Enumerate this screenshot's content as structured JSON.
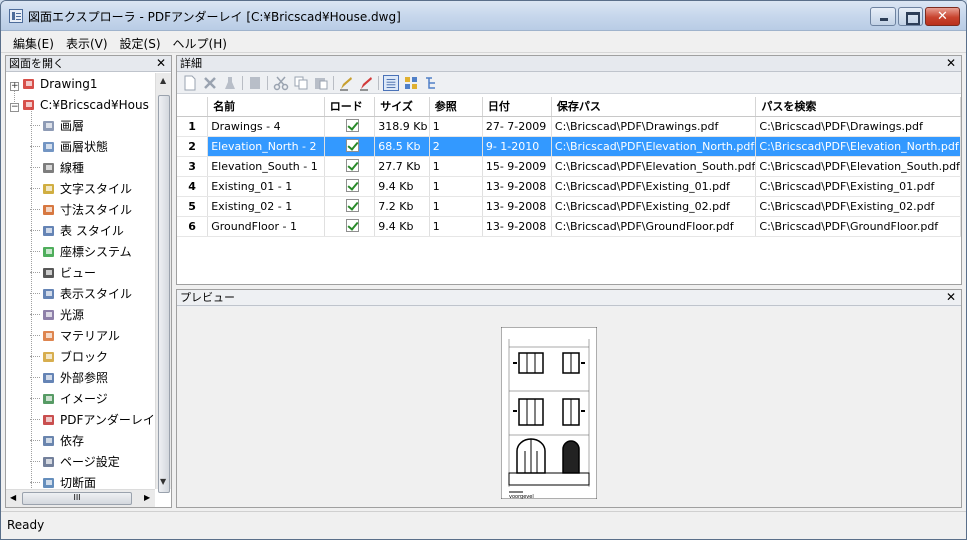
{
  "window": {
    "title": "図面エクスプローラ - PDFアンダーレイ [C:¥Bricscad¥House.dwg]",
    "close_glyph": "✕"
  },
  "menu": [
    "編集(E)",
    "表示(V)",
    "設定(S)",
    "ヘルプ(H)"
  ],
  "left_panel": {
    "title": "図面を開く",
    "close": "✕",
    "tree": [
      {
        "label": "Drawing1",
        "icon": "drawing-icon",
        "level": 0,
        "expander": "+"
      },
      {
        "label": "C:¥Bricscad¥Hous",
        "icon": "drawing-icon",
        "level": 0,
        "expander": "−"
      },
      {
        "label": "画層",
        "icon": "layers-icon",
        "level": 1
      },
      {
        "label": "画層状態",
        "icon": "layer-states-icon",
        "level": 1
      },
      {
        "label": "線種",
        "icon": "linetype-icon",
        "level": 1
      },
      {
        "label": "文字スタイル",
        "icon": "text-style-icon",
        "level": 1
      },
      {
        "label": "寸法スタイル",
        "icon": "dimension-style-icon",
        "level": 1
      },
      {
        "label": "表 スタイル",
        "icon": "table-style-icon",
        "level": 1
      },
      {
        "label": "座標システム",
        "icon": "ucs-icon",
        "level": 1
      },
      {
        "label": "ビュー",
        "icon": "view-icon",
        "level": 1
      },
      {
        "label": "表示スタイル",
        "icon": "visual-style-icon",
        "level": 1
      },
      {
        "label": "光源",
        "icon": "light-icon",
        "level": 1
      },
      {
        "label": "マテリアル",
        "icon": "material-icon",
        "level": 1
      },
      {
        "label": "ブロック",
        "icon": "block-icon",
        "level": 1
      },
      {
        "label": "外部参照",
        "icon": "xref-icon",
        "level": 1
      },
      {
        "label": "イメージ",
        "icon": "image-icon",
        "level": 1
      },
      {
        "label": "PDFアンダーレイ",
        "icon": "pdf-underlay-icon",
        "level": 1
      },
      {
        "label": "依存",
        "icon": "dependency-icon",
        "level": 1
      },
      {
        "label": "ページ設定",
        "icon": "page-setup-icon",
        "level": 1
      },
      {
        "label": "切断面",
        "icon": "section-icon",
        "level": 1
      }
    ],
    "hscroll_grip": "III"
  },
  "details": {
    "title": "詳細",
    "close": "✕",
    "columns": [
      "",
      "名前",
      "ロード",
      "サイズ",
      "参照",
      "日付",
      "保存パス",
      "パスを検索"
    ],
    "rows": [
      {
        "num": "1",
        "name": "Drawings - 4",
        "loaded": true,
        "size": "318.9 Kb",
        "refs": "1",
        "date": "27- 7-2009",
        "saved_path": "C:\\Bricscad\\PDF\\Drawings.pdf",
        "found_path": "C:\\Bricscad\\PDF\\Drawings.pdf",
        "selected": false
      },
      {
        "num": "2",
        "name": "Elevation_North - 2",
        "loaded": true,
        "size": "68.5 Kb",
        "refs": "2",
        "date": "9- 1-2010",
        "saved_path": "C:\\Bricscad\\PDF\\Elevation_North.pdf",
        "found_path": "C:\\Bricscad\\PDF\\Elevation_North.pdf",
        "selected": true
      },
      {
        "num": "3",
        "name": "Elevation_South - 1",
        "loaded": true,
        "size": "27.7 Kb",
        "refs": "1",
        "date": "15- 9-2009",
        "saved_path": "C:\\Bricscad\\PDF\\Elevation_South.pdf",
        "found_path": "C:\\Bricscad\\PDF\\Elevation_South.pdf",
        "selected": false
      },
      {
        "num": "4",
        "name": "Existing_01 - 1",
        "loaded": true,
        "size": "9.4 Kb",
        "refs": "1",
        "date": "13- 9-2008",
        "saved_path": "C:\\Bricscad\\PDF\\Existing_01.pdf",
        "found_path": "C:\\Bricscad\\PDF\\Existing_01.pdf",
        "selected": false
      },
      {
        "num": "5",
        "name": "Existing_02 - 1",
        "loaded": true,
        "size": "7.2 Kb",
        "refs": "1",
        "date": "13- 9-2008",
        "saved_path": "C:\\Bricscad\\PDF\\Existing_02.pdf",
        "found_path": "C:\\Bricscad\\PDF\\Existing_02.pdf",
        "selected": false
      },
      {
        "num": "6",
        "name": "GroundFloor - 1",
        "loaded": true,
        "size": "9.4 Kb",
        "refs": "1",
        "date": "13- 9-2008",
        "saved_path": "C:\\Bricscad\\PDF\\GroundFloor.pdf",
        "found_path": "C:\\Bricscad\\PDF\\GroundFloor.pdf",
        "selected": false
      }
    ]
  },
  "preview": {
    "title": "プレビュー",
    "close": "✕",
    "caption": "voorgevel"
  },
  "status": {
    "text": "Ready"
  }
}
